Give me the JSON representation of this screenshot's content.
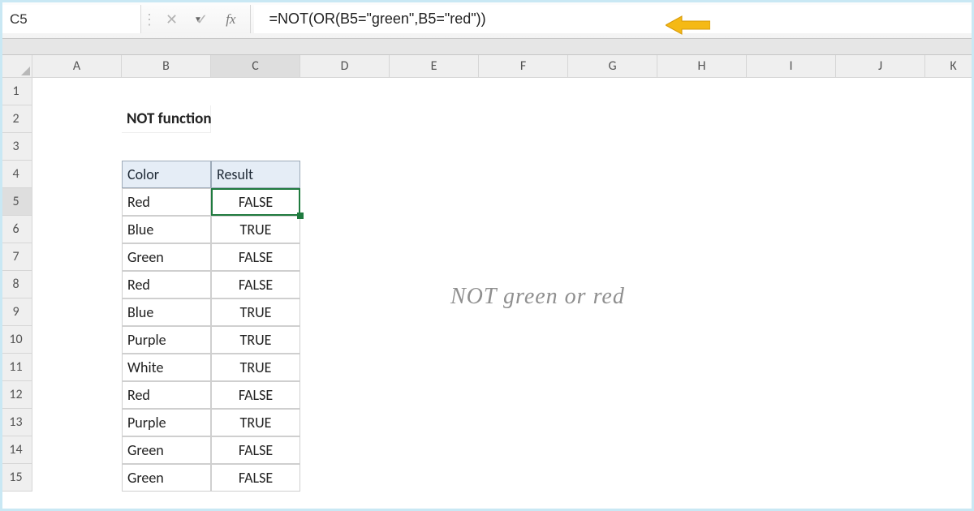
{
  "namebox": {
    "value": "C5"
  },
  "formula": {
    "value": "=NOT(OR(B5=\"green\",B5=\"red\"))"
  },
  "fb_buttons": {
    "cancel": "✕",
    "enter": "✓",
    "fx": "fx"
  },
  "columns": [
    "A",
    "B",
    "C",
    "D",
    "E",
    "F",
    "G",
    "H",
    "I",
    "J",
    "K"
  ],
  "rows": [
    "1",
    "2",
    "3",
    "4",
    "5",
    "6",
    "7",
    "8",
    "9",
    "10",
    "11",
    "12",
    "13",
    "14",
    "15"
  ],
  "title": "NOT function",
  "table": {
    "headers": {
      "color": "Color",
      "result": "Result"
    },
    "rows": [
      {
        "color": "Red",
        "result": "FALSE"
      },
      {
        "color": "Blue",
        "result": "TRUE"
      },
      {
        "color": "Green",
        "result": "FALSE"
      },
      {
        "color": "Red",
        "result": "FALSE"
      },
      {
        "color": "Blue",
        "result": "TRUE"
      },
      {
        "color": "Purple",
        "result": "TRUE"
      },
      {
        "color": "White",
        "result": "TRUE"
      },
      {
        "color": "Red",
        "result": "FALSE"
      },
      {
        "color": "Purple",
        "result": "TRUE"
      },
      {
        "color": "Green",
        "result": "FALSE"
      },
      {
        "color": "Green",
        "result": "FALSE"
      }
    ]
  },
  "annotation": "NOT green or red",
  "active_cell": {
    "col": "C",
    "row": "5"
  }
}
